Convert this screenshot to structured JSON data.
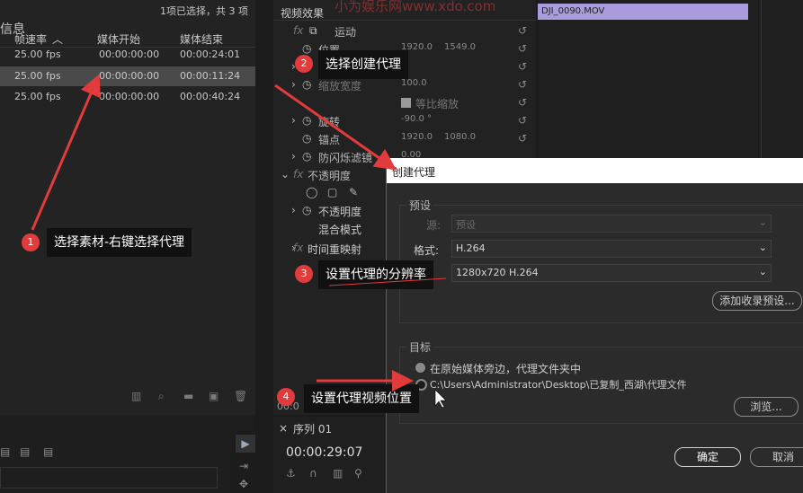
{
  "project": {
    "title_fragment": "信息",
    "selection_status": "1项已选择，共 3 项",
    "columns": [
      "帧速率",
      "媒体开始",
      "媒体结束"
    ],
    "rows": [
      {
        "fps": "25.00 fps",
        "start": "00:00:00:00",
        "end": "00:00:24:01"
      },
      {
        "fps": "25.00 fps",
        "start": "00:00:00:00",
        "end": "00:00:11:24"
      },
      {
        "fps": "25.00 fps",
        "start": "00:00:00:00",
        "end": "00:00:40:24"
      }
    ]
  },
  "effects": {
    "title": "视频效果",
    "clip_name": "DJI_0090.MOV",
    "items": [
      {
        "label": "运动",
        "v1": "",
        "v2": ""
      },
      {
        "label": "位置",
        "v1": "1920.0",
        "v2": "1549.0"
      },
      {
        "label": "缩放",
        "v1": "",
        "v2": ""
      },
      {
        "label": "缩放宽度",
        "v1": "100.0",
        "v2": ""
      },
      {
        "label": "等比缩放",
        "v1": "",
        "v2": ""
      },
      {
        "label": "旋转",
        "v1": "-90.0 °",
        "v2": ""
      },
      {
        "label": "锚点",
        "v1": "1920.0",
        "v2": "1080.0"
      },
      {
        "label": "防闪烁滤镜",
        "v1": "0.00",
        "v2": ""
      },
      {
        "label": "不透明度",
        "v1": "",
        "v2": ""
      },
      {
        "label": "不透明度",
        "v1": "",
        "v2": ""
      },
      {
        "label": "混合模式",
        "v1": "",
        "v2": ""
      },
      {
        "label": "时间重映射",
        "v1": "",
        "v2": ""
      }
    ]
  },
  "sequence": {
    "tab": "序列 01",
    "timecode": "00:00:29:07",
    "small_timecode": "00:0"
  },
  "dialog": {
    "title": "创建代理",
    "preset_group": "预设",
    "source_label": "源:",
    "source_value": "预设",
    "format_label": "格式:",
    "format_value": "H.264",
    "preset_value": "1280x720 H.264",
    "add_preset_btn": "添加收录预设...",
    "target_group": "目标",
    "option1": "在原始媒体旁边，代理文件夹中",
    "option2": "C:\\Users\\Administrator\\Desktop\\已复制_西湖\\代理文件",
    "browse_btn": "浏览...",
    "ok_btn": "确定",
    "cancel_btn": "取消"
  },
  "callouts": [
    {
      "num": "1",
      "text": "选择素材-右键选择代理"
    },
    {
      "num": "2",
      "text": "选择创建代理"
    },
    {
      "num": "3",
      "text": "设置代理的分辨率"
    },
    {
      "num": "4",
      "text": "设置代理视频位置"
    }
  ],
  "watermark": "小为娱乐网www.xdo.com",
  "colors": {
    "accent": "#e13b3b",
    "clip": "#a99bdc",
    "dialog_border": "#3a64a8"
  }
}
